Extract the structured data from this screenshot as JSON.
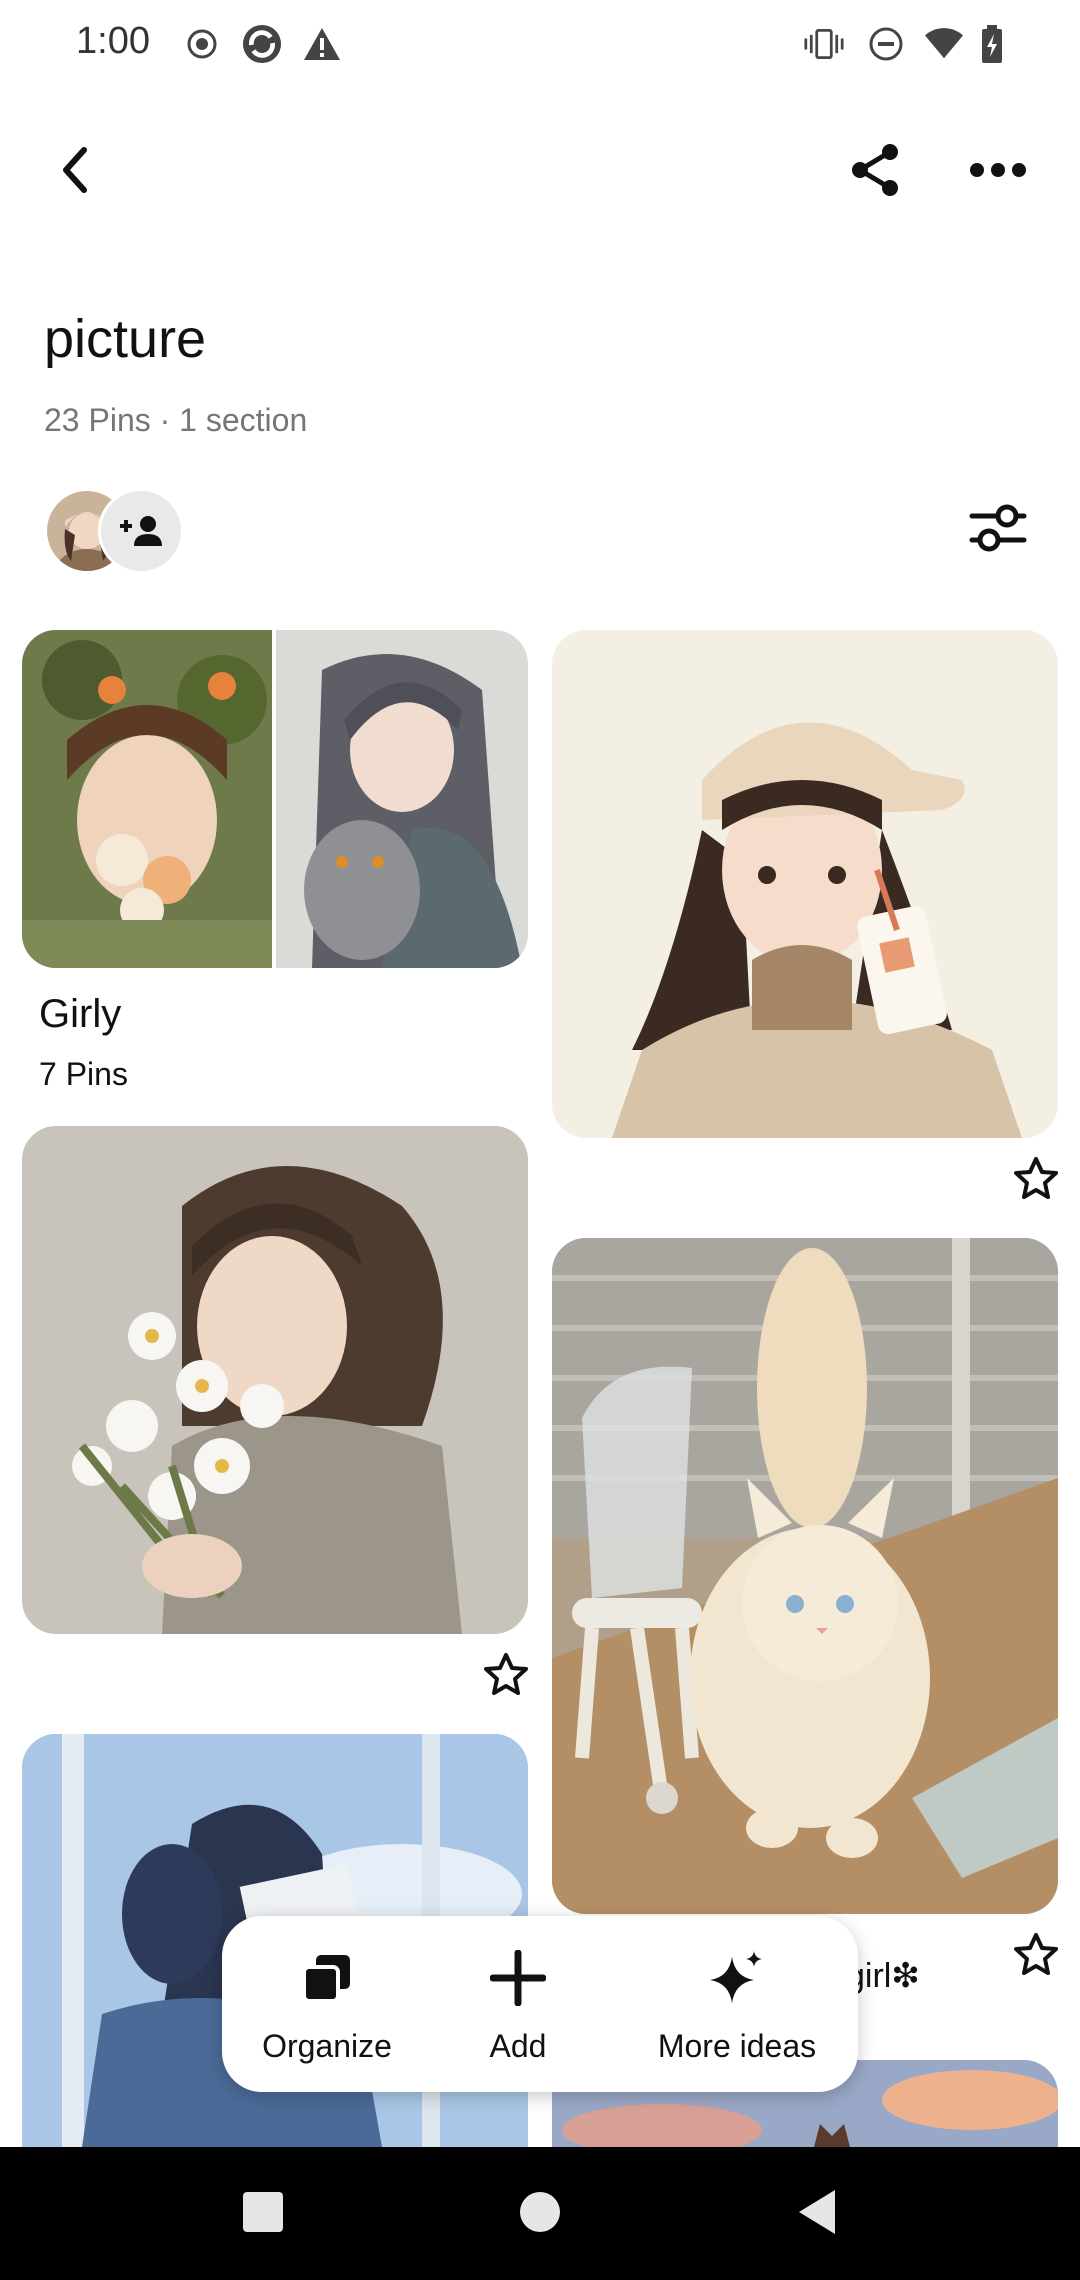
{
  "status_bar": {
    "time": "1:00",
    "left_icons": [
      "record-icon",
      "sync-icon",
      "warning-icon"
    ],
    "right_icons": [
      "vibrate-icon",
      "do-not-disturb-icon",
      "wifi-icon",
      "battery-charging-icon"
    ]
  },
  "top_bar": {
    "back_icon": "back-arrow-icon",
    "share_icon": "share-icon",
    "more_icon": "more-horizontal-icon"
  },
  "board": {
    "title": "picture",
    "meta": "23 Pins · 1 section"
  },
  "section": {
    "title": "Girly",
    "count": "7 Pins"
  },
  "pins": {
    "partial_caption": "girl❇"
  },
  "action_bar": {
    "organize_label": "Organize",
    "add_label": "Add",
    "more_ideas_label": "More ideas"
  },
  "colors": {
    "text_primary": "#111111",
    "text_secondary": "#767676",
    "collab_bg": "#e9e9e9",
    "nav_bg": "#000000"
  }
}
